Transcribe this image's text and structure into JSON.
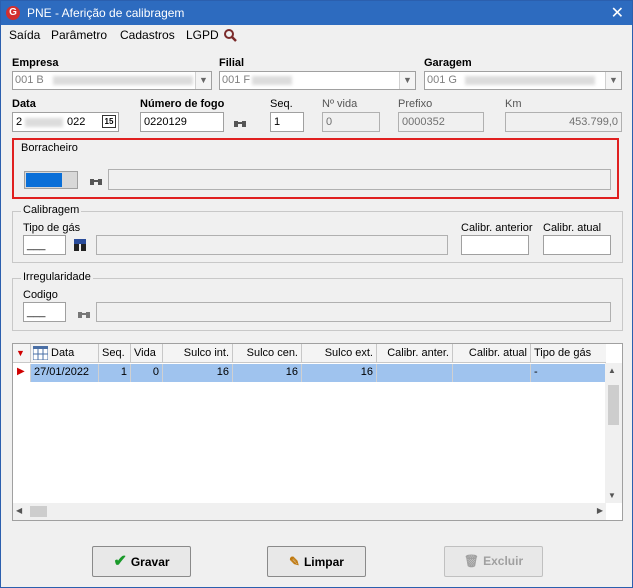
{
  "window": {
    "title": "PNE - Aferição de calibragem",
    "close": "✕",
    "app_icon": "G"
  },
  "menu": [
    "Saída",
    "Parâmetro",
    "Cadastros",
    "LGPD"
  ],
  "fields": {
    "empresa_label": "Empresa",
    "empresa_value": "001 B",
    "filial_label": "Filial",
    "filial_value": "001 F",
    "garagem_label": "Garagem",
    "garagem_value": "001 G",
    "data_label": "Data",
    "data_prefix": "2",
    "data_suffix": "022",
    "numero_fogo_label": "Número de fogo",
    "numero_fogo_value": "0220129",
    "seq_label": "Seq.",
    "seq_value": "1",
    "nvida_label": "Nº vida",
    "nvida_value": "0",
    "prefixo_label": "Prefixo",
    "prefixo_value": "0000352",
    "km_label": "Km",
    "km_value": "453.799,0"
  },
  "borracheiro": {
    "title": "Borracheiro"
  },
  "calibragem": {
    "title": "Calibragem",
    "tipo_gas_label": "Tipo de gás",
    "tipo_gas_value": "___",
    "calibr_anterior_label": "Calibr. anterior",
    "calibr_atual_label": "Calibr. atual"
  },
  "irregularidade": {
    "title": "Irregularidade",
    "codigo_label": "Codigo",
    "codigo_value": "___"
  },
  "grid": {
    "columns": [
      "Data",
      "Seq.",
      "Vida",
      "Sulco int.",
      "Sulco cen.",
      "Sulco ext.",
      "Calibr. anter.",
      "Calibr. atual",
      "Tipo de gás"
    ],
    "rows": [
      {
        "data": "27/01/2022",
        "seq": "1",
        "vida": "0",
        "sulco_int": "16",
        "sulco_cen": "16",
        "sulco_ext": "16",
        "calibr_anter": "",
        "calibr_atual": "",
        "tipo_gas": "-"
      }
    ]
  },
  "buttons": {
    "gravar": "Gravar",
    "limpar": "Limpar",
    "excluir": "Excluir"
  },
  "colors": {
    "titlebar": "#2d6bbf",
    "selected_row": "#9fc3ee",
    "highlight_border": "#e02020",
    "focus_input": "#0a6fd8"
  }
}
